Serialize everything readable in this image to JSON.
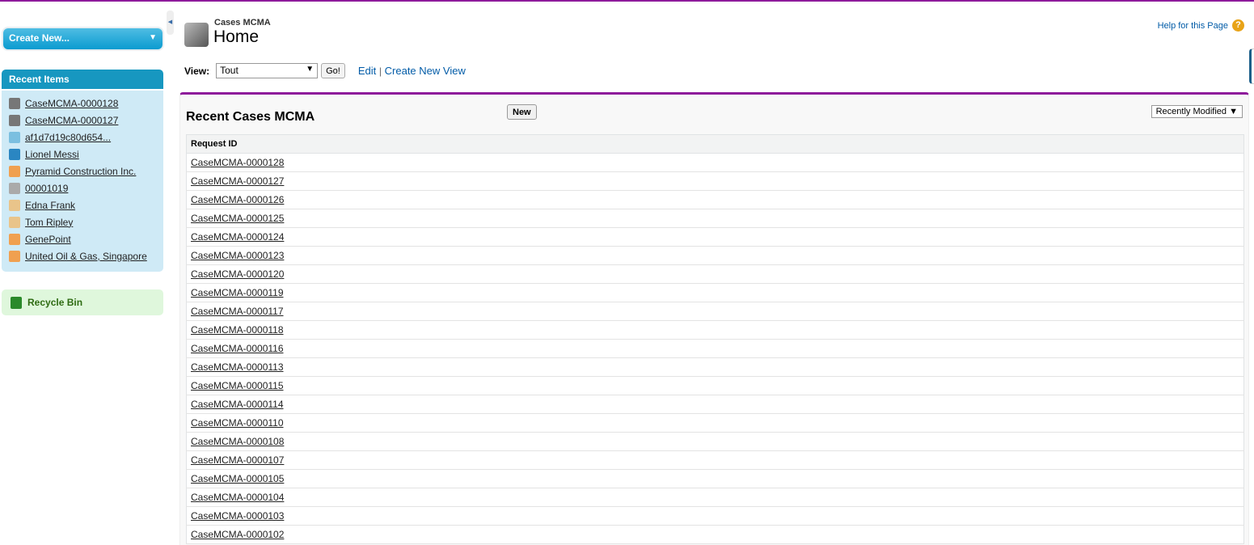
{
  "sidebar": {
    "create_new": "Create New...",
    "recent_items_title": "Recent Items",
    "recent_items": [
      {
        "label": "CaseMCMA-0000128",
        "icon": "safe-icon",
        "color": "#777"
      },
      {
        "label": "CaseMCMA-0000127",
        "icon": "safe-icon",
        "color": "#777"
      },
      {
        "label": "af1d7d19c80d654...",
        "icon": "file-icon",
        "color": "#7bbfe0"
      },
      {
        "label": "Lionel Messi",
        "icon": "person-icon",
        "color": "#2a86c2"
      },
      {
        "label": "Pyramid Construction Inc.",
        "icon": "account-folder-icon",
        "color": "#f0a050"
      },
      {
        "label": "00001019",
        "icon": "case-icon",
        "color": "#aaa"
      },
      {
        "label": "Edna Frank",
        "icon": "contact-card-icon",
        "color": "#e9c48a"
      },
      {
        "label": "Tom Ripley",
        "icon": "contact-card-icon",
        "color": "#e9c48a"
      },
      {
        "label": "GenePoint",
        "icon": "account-folder-icon",
        "color": "#f0a050"
      },
      {
        "label": "United Oil & Gas, Singapore",
        "icon": "account-folder-icon",
        "color": "#f0a050"
      }
    ],
    "recycle_bin": "Recycle Bin"
  },
  "header": {
    "object": "Cases MCMA",
    "title": "Home",
    "help": "Help for this Page",
    "help_icon": "?"
  },
  "view": {
    "label": "View:",
    "selected": "Tout",
    "go": "Go!",
    "edit": "Edit",
    "sep": "|",
    "create_new_view": "Create New View"
  },
  "recent": {
    "title": "Recent Cases MCMA",
    "new": "New",
    "sort": "Recently Modified",
    "column": "Request ID",
    "rows": [
      "CaseMCMA-0000128",
      "CaseMCMA-0000127",
      "CaseMCMA-0000126",
      "CaseMCMA-0000125",
      "CaseMCMA-0000124",
      "CaseMCMA-0000123",
      "CaseMCMA-0000120",
      "CaseMCMA-0000119",
      "CaseMCMA-0000117",
      "CaseMCMA-0000118",
      "CaseMCMA-0000116",
      "CaseMCMA-0000113",
      "CaseMCMA-0000115",
      "CaseMCMA-0000114",
      "CaseMCMA-0000110",
      "CaseMCMA-0000108",
      "CaseMCMA-0000107",
      "CaseMCMA-0000105",
      "CaseMCMA-0000104",
      "CaseMCMA-0000103",
      "CaseMCMA-0000102"
    ]
  }
}
